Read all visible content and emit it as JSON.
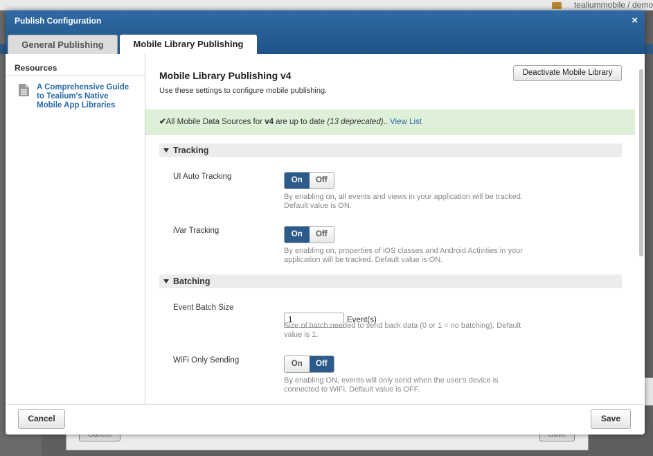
{
  "background": {
    "user_text": "tealiummobile  /  demo",
    "cancel_label": "Cancel",
    "save_label": "Save"
  },
  "modal": {
    "title": "Publish Configuration",
    "close_icon": "×",
    "tabs": [
      {
        "label": "General Publishing",
        "active": false
      },
      {
        "label": "Mobile Library Publishing",
        "active": true
      }
    ]
  },
  "sidebar": {
    "title": "Resources",
    "items": [
      {
        "icon": "document-icon",
        "label": "A Comprehensive Guide to Tealium's Native Mobile App Libraries"
      }
    ]
  },
  "content": {
    "title": "Mobile Library Publishing v4",
    "description": "Use these settings to configure mobile publishing.",
    "deactivate_label": "Deactivate Mobile Library",
    "status": {
      "check": "✔",
      "prefix": "All Mobile Data Sources for ",
      "version": "v4",
      "middle": " are up to date ",
      "deprecated": "(13 deprecated)",
      "suffix": ".. ",
      "link": "View List"
    },
    "sections": {
      "tracking": {
        "title": "Tracking",
        "ui_auto": {
          "label": "UI Auto Tracking",
          "on": "On",
          "off": "Off",
          "value": "On",
          "help": "By enabling on, all events and views in your application will be tracked. Default value is ON."
        },
        "ivar": {
          "label": "iVar Tracking",
          "on": "On",
          "off": "Off",
          "value": "On",
          "help": "By enabling on, properties of iOS classes and Android Activities in your application will be tracked. Default value is ON."
        }
      },
      "batching": {
        "title": "Batching",
        "batch_size": {
          "label": "Event Batch Size",
          "value": "1",
          "unit": "Event(s)",
          "help": "Size of batch needed to send back data (0 or 1 = no batching). Default value is 1."
        },
        "wifi_only": {
          "label": "WiFi Only Sending",
          "on": "On",
          "off": "Off",
          "value": "Off",
          "help": "By enabling ON, events will only send when the user's device is connected to WiFi. Default value is OFF."
        }
      }
    }
  },
  "footer": {
    "cancel_label": "Cancel",
    "save_label": "Save"
  },
  "colors": {
    "header_blue": "#1f5388",
    "toggle_selected": "#2c5a8a",
    "status_bg": "#dff0d8",
    "link": "#2a6aa8"
  }
}
